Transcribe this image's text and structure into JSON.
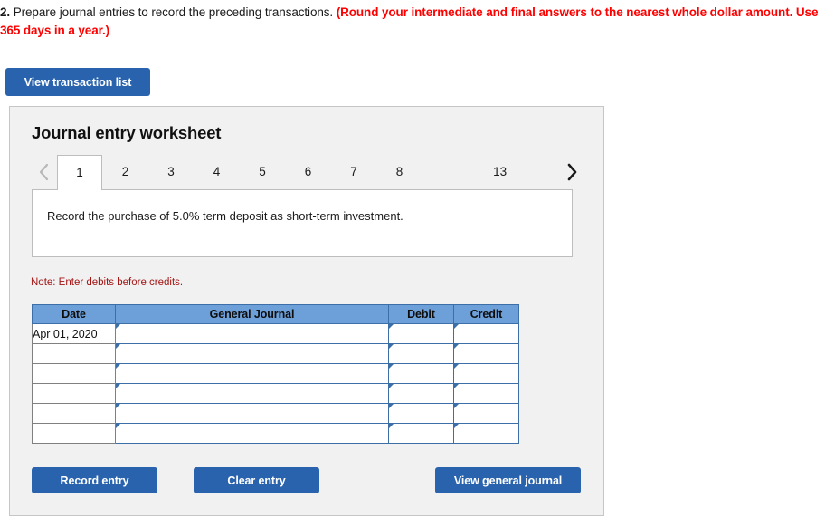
{
  "question": {
    "number": "2.",
    "text": " Prepare journal entries to record the preceding transactions. ",
    "emphasis": "(Round your intermediate and final answers to the nearest whole dollar amount. Use 365 days in a year.)",
    "emphasis_color": "#ff0000"
  },
  "toolbar": {
    "view_transaction_list_label": "View transaction list"
  },
  "worksheet": {
    "title": "Journal entry worksheet",
    "prev_icon": "chevron-left-icon",
    "next_icon": "chevron-right-icon",
    "prev_enabled": "false",
    "next_enabled": "true",
    "tabs": [
      {
        "label": "1",
        "active": "true"
      },
      {
        "label": "2",
        "active": "false"
      },
      {
        "label": "3",
        "active": "false"
      },
      {
        "label": "4",
        "active": "false"
      },
      {
        "label": "5",
        "active": "false"
      },
      {
        "label": "6",
        "active": "false"
      },
      {
        "label": "7",
        "active": "false"
      },
      {
        "label": "8",
        "active": "false"
      },
      {
        "label": "13",
        "active": "false"
      }
    ],
    "prompt": "Record the purchase of 5.0% term deposit as short-term investment.",
    "note": "Note: Enter debits before credits.",
    "table": {
      "headers": [
        "Date",
        "General Journal",
        "Debit",
        "Credit"
      ],
      "rows": [
        {
          "date": "Apr 01, 2020",
          "general_journal": "",
          "debit": "",
          "credit": ""
        },
        {
          "date": "",
          "general_journal": "",
          "debit": "",
          "credit": ""
        },
        {
          "date": "",
          "general_journal": "",
          "debit": "",
          "credit": ""
        },
        {
          "date": "",
          "general_journal": "",
          "debit": "",
          "credit": ""
        },
        {
          "date": "",
          "general_journal": "",
          "debit": "",
          "credit": ""
        },
        {
          "date": "",
          "general_journal": "",
          "debit": "",
          "credit": ""
        }
      ]
    },
    "actions": {
      "record_entry_label": "Record entry",
      "clear_entry_label": "Clear entry",
      "view_general_journal_label": "View general journal"
    }
  },
  "colors": {
    "button_blue": "#2a63ad",
    "table_header_blue": "#6d9fd8",
    "cell_border_blue": "#3c6fa8",
    "panel_bg": "#f1f1f1",
    "note_red": "#a31515"
  }
}
